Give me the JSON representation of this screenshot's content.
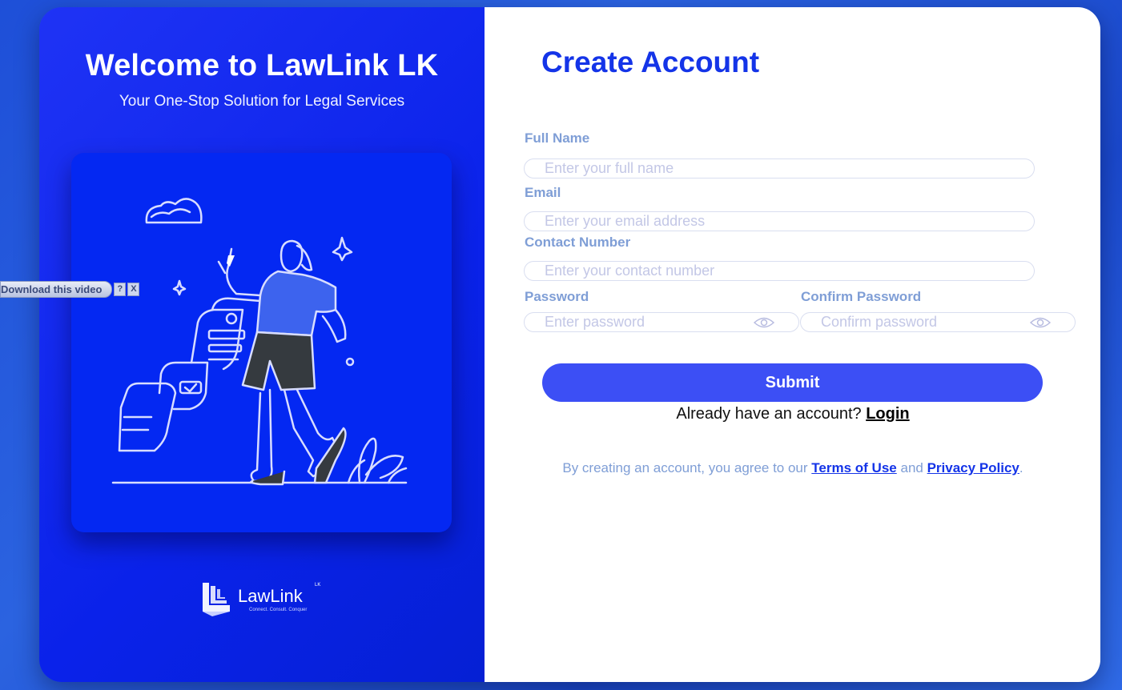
{
  "hero": {
    "title": "Welcome to LawLink LK",
    "subtitle": "Your One-Stop Solution for Legal Services"
  },
  "logo": {
    "name": "LawLink",
    "superscript": "LK",
    "tagline": "Connect. Consult. Conquer"
  },
  "form": {
    "heading": "Create Account",
    "full_name": {
      "label": "Full Name",
      "placeholder": "Enter your full name"
    },
    "email": {
      "label": "Email",
      "placeholder": "Enter your email address"
    },
    "contact": {
      "label": "Contact Number",
      "placeholder": "Enter your contact number"
    },
    "password": {
      "label": "Password",
      "placeholder": "Enter password"
    },
    "confirm_password": {
      "label": "Confirm Password",
      "placeholder": "Confirm password"
    },
    "submit_label": "Submit",
    "login_prompt": "Already have an account?",
    "login_link": "Login",
    "terms_prefix": "By creating an account, you agree to our",
    "terms_link": "Terms of Use",
    "terms_and": "and",
    "privacy_link": "Privacy Policy",
    "terms_suffix": "."
  },
  "overlay": {
    "download_label": "Download this video",
    "help_label": "?",
    "close_label": "X"
  },
  "colors": {
    "accent": "#1434e8",
    "submit": "#3c4ff5",
    "label": "#7f9ed6",
    "panel": "#0a22ea"
  },
  "icons": {
    "password_toggle": "eye-icon",
    "confirm_toggle": "eye-icon",
    "logo": "lawlink-logo-icon"
  }
}
